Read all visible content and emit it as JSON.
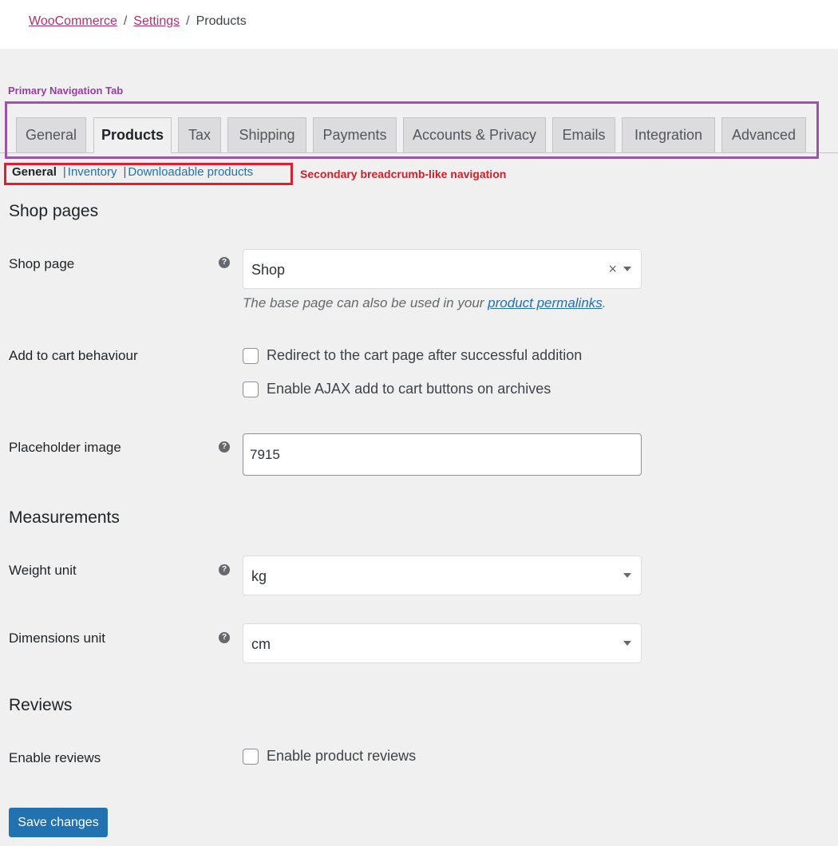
{
  "breadcrumb": {
    "items": [
      "WooCommerce",
      "Settings",
      "Products"
    ],
    "separator": "/"
  },
  "annotations": {
    "primary_nav": "Primary Navigation Tab",
    "secondary_nav": "Secondary breadcrumb-like navigation"
  },
  "tabs": [
    {
      "label": "General"
    },
    {
      "label": "Products",
      "active": true
    },
    {
      "label": "Tax"
    },
    {
      "label": "Shipping"
    },
    {
      "label": "Payments"
    },
    {
      "label": "Accounts & Privacy"
    },
    {
      "label": "Emails"
    },
    {
      "label": "Integration"
    },
    {
      "label": "Advanced"
    }
  ],
  "subnav": {
    "current": "General",
    "links": [
      "Inventory",
      "Downloadable products"
    ],
    "separator": "|"
  },
  "sections": {
    "shop_pages": "Shop pages",
    "measurements": "Measurements",
    "reviews": "Reviews"
  },
  "fields": {
    "shop_page": {
      "label": "Shop page",
      "value": "Shop",
      "clear_glyph": "×",
      "description_prefix": "The base page can also be used in your",
      "description_link": "product permalinks",
      "description_suffix": "."
    },
    "add_to_cart": {
      "label": "Add to cart behaviour",
      "option_redirect": "Redirect to the cart page after successful addition",
      "option_ajax": "Enable AJAX add to cart buttons on archives"
    },
    "placeholder_image": {
      "label": "Placeholder image",
      "value": "7915"
    },
    "weight_unit": {
      "label": "Weight unit",
      "value": "kg"
    },
    "dimensions_unit": {
      "label": "Dimensions unit",
      "value": "cm"
    },
    "enable_reviews": {
      "label": "Enable reviews",
      "option": "Enable product reviews"
    }
  },
  "help_glyph": "?",
  "save_label": "Save changes",
  "colors": {
    "link_woo": "#b42d6e",
    "link_blue": "#2271b1",
    "annot_purple": "#9b55a8",
    "annot_red": "#e01e2e",
    "button": "#2271b1"
  },
  "icons": [
    "help-icon",
    "clear-icon",
    "caret-down-icon"
  ]
}
